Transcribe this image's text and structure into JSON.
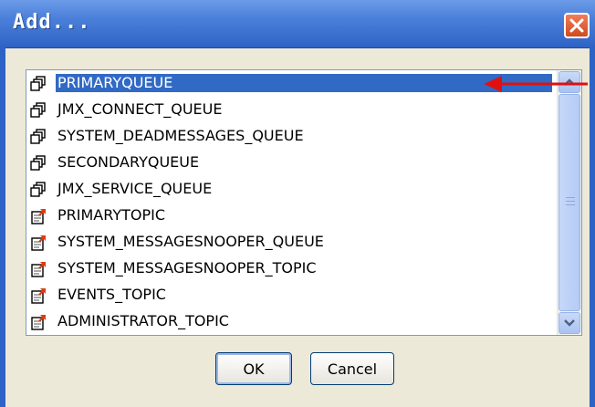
{
  "window": {
    "title": "Add...",
    "close_icon": "close-icon"
  },
  "list": {
    "selected_index": 0,
    "items": [
      {
        "label": "PRIMARYQUEUE",
        "icon": "queue-icon"
      },
      {
        "label": "JMX_CONNECT_QUEUE",
        "icon": "queue-icon"
      },
      {
        "label": "SYSTEM_DEADMESSAGES_QUEUE",
        "icon": "queue-icon"
      },
      {
        "label": "SECONDARYQUEUE",
        "icon": "queue-icon"
      },
      {
        "label": "JMX_SERVICE_QUEUE",
        "icon": "queue-icon"
      },
      {
        "label": "PRIMARYTOPIC",
        "icon": "topic-icon"
      },
      {
        "label": "SYSTEM_MESSAGESNOOPER_QUEUE",
        "icon": "topic-icon"
      },
      {
        "label": "SYSTEM_MESSAGESNOOPER_TOPIC",
        "icon": "topic-icon"
      },
      {
        "label": "EVENTS_TOPIC",
        "icon": "topic-icon"
      },
      {
        "label": "ADMINISTRATOR_TOPIC",
        "icon": "topic-icon"
      }
    ]
  },
  "buttons": {
    "ok": "OK",
    "cancel": "Cancel"
  },
  "colors": {
    "selection": "#316ac5",
    "titlebar": "#2e63c6",
    "annotation_arrow": "#e01010"
  }
}
